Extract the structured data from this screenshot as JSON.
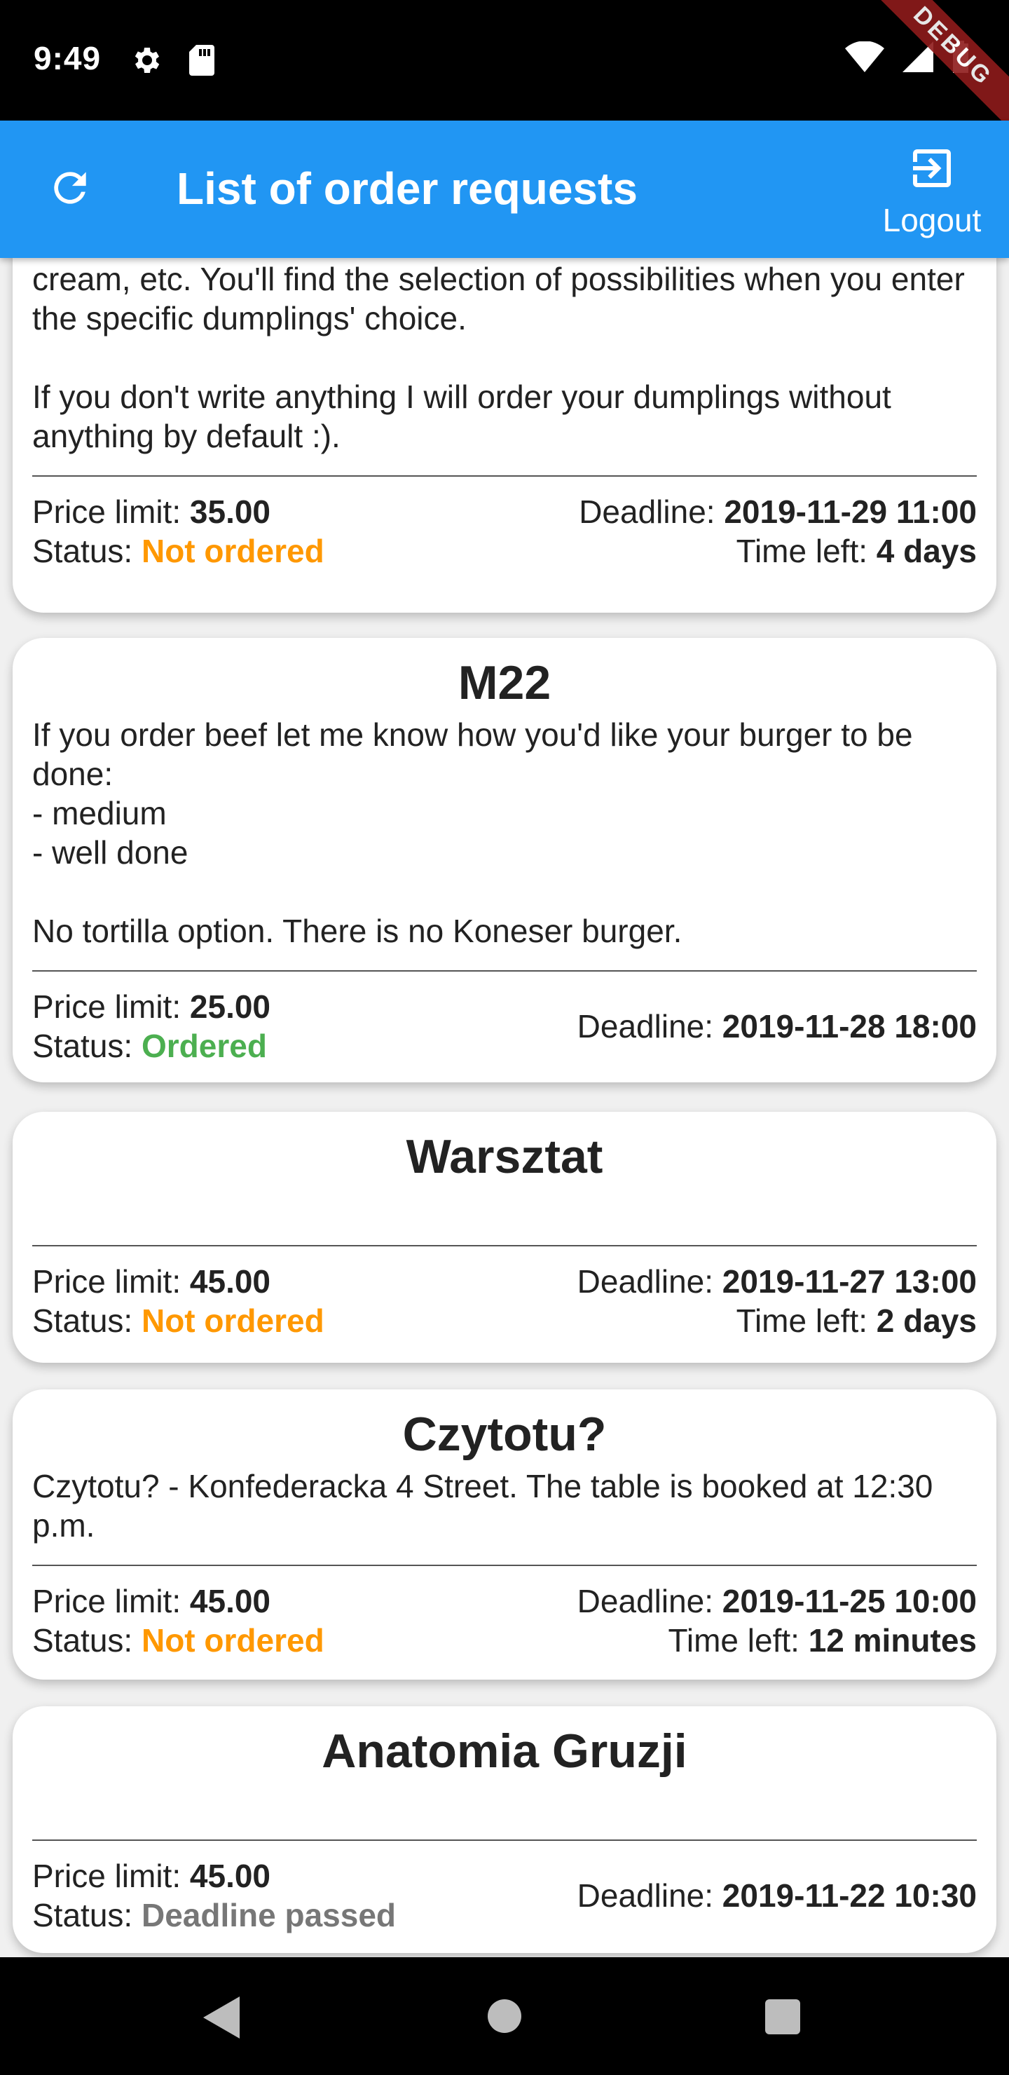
{
  "status_bar": {
    "time": "9:49",
    "debug_label": "DEBUG"
  },
  "app_bar": {
    "title": "List of order requests",
    "logout_label": "Logout"
  },
  "labels": {
    "price_limit": "Price limit:",
    "status": "Status:",
    "deadline": "Deadline:",
    "time_left": "Time left:"
  },
  "cards": [
    {
      "title": "",
      "description": "Let me know if you want your dumplings with any sauce, dip or cream, etc. You'll find the selection of possibilities when you enter the specific dumplings' choice.\n\nIf you don't write anything I will order your dumplings without anything by default :).",
      "price_limit": "35.00",
      "status": "Not ordered",
      "deadline": "2019-11-29 11:00",
      "time_left": "4 days"
    },
    {
      "title": "M22",
      "description": "If you order beef let me know how you'd like your burger to be done:\n- medium\n- well done\n\nNo tortilla option. There is no Koneser burger.",
      "price_limit": "25.00",
      "status": "Ordered",
      "deadline": "2019-11-28 18:00",
      "time_left": ""
    },
    {
      "title": "Warsztat",
      "description": "",
      "price_limit": "45.00",
      "status": "Not ordered",
      "deadline": "2019-11-27 13:00",
      "time_left": "2 days"
    },
    {
      "title": "Czytotu?",
      "description": "Czytotu? - Konfederacka 4 Street. The table is booked at 12:30 p.m.",
      "price_limit": "45.00",
      "status": "Not ordered",
      "deadline": "2019-11-25 10:00",
      "time_left": "12 minutes"
    },
    {
      "title": "Anatomia Gruzji",
      "description": "",
      "price_limit": "45.00",
      "status": "Deadline passed",
      "deadline": "2019-11-22 10:30",
      "time_left": ""
    }
  ],
  "colors": {
    "app_bar": "#2196f3",
    "not_ordered": "#ff9800",
    "ordered": "#4caf50",
    "deadline_passed": "#777777"
  },
  "icons": {
    "refresh": "refresh-icon",
    "logout": "logout-icon",
    "settings": "gear-icon",
    "sd_card": "sd-card-icon",
    "wifi": "wifi-icon",
    "signal": "signal-icon",
    "battery": "battery-icon",
    "nav_back": "back-triangle-icon",
    "nav_home": "home-circle-icon",
    "nav_recents": "recents-square-icon"
  }
}
